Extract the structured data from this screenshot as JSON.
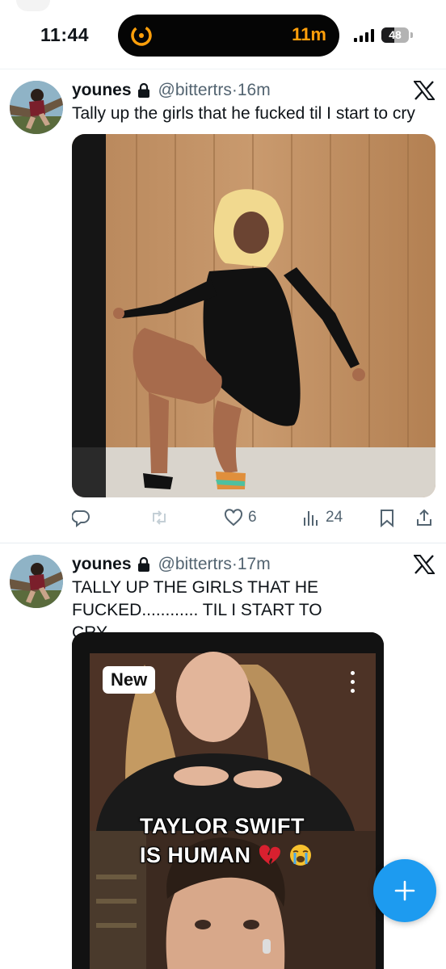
{
  "status_bar": {
    "time": "11:44",
    "timer": "11m",
    "battery": "48",
    "battery_level": 0.48,
    "accent_color": "#ff9f0a"
  },
  "tweets": [
    {
      "display_name": "younes",
      "handle": "@bittertrs",
      "separator": "·",
      "time_ago": "16m",
      "text": "Tally up the girls that he fucked til I start to cry",
      "media_type": "photo",
      "actions": {
        "reply": "",
        "retweet": "",
        "likes": "6",
        "views": "24"
      }
    },
    {
      "display_name": "younes",
      "handle": "@bittertrs",
      "separator": "·",
      "time_ago": "17m",
      "text": "TALLY UP THE GIRLS THAT HE FUCKED............ TIL I START TO CRY...............",
      "media_type": "video-screenshot",
      "media": {
        "badge": "New",
        "caption_line1": "TAYLOR SWIFT",
        "caption_line2": "IS HUMAN"
      }
    }
  ],
  "icons": {
    "lock": "lock-icon",
    "platform": "x-logo-icon",
    "reply": "reply-icon",
    "retweet": "retweet-icon",
    "like": "heart-outline-icon",
    "views": "bar-chart-icon",
    "bookmark": "bookmark-icon",
    "share": "share-icon",
    "compose": "plus-icon"
  },
  "colors": {
    "link_blue": "#1d9bf0",
    "secondary_text": "#536471",
    "primary_text": "#0f1419"
  }
}
